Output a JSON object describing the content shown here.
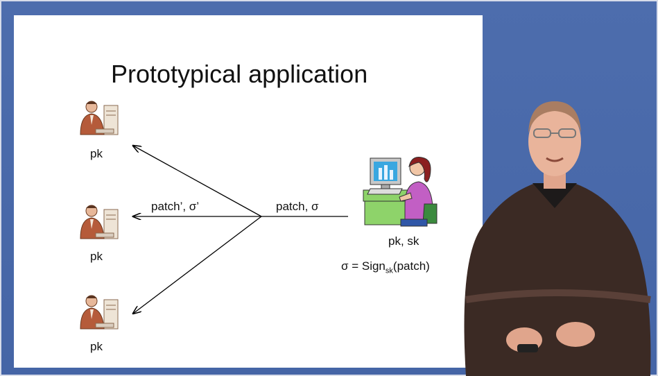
{
  "slide": {
    "title": "Prototypical application",
    "recipients": [
      {
        "label": "pk"
      },
      {
        "label": "pk"
      },
      {
        "label": "pk"
      }
    ],
    "sender": {
      "keys_label": "pk, sk",
      "formula_prefix": "σ = Sign",
      "formula_sub": "sk",
      "formula_suffix": "(patch)"
    },
    "edge_labels": {
      "incoming": "patch, σ",
      "outgoing": "patch’, σ’"
    }
  },
  "colors": {
    "background_blue": "#4a6aaa",
    "slide_white": "#ffffff",
    "sender_shirt": "#c25fc4",
    "recipient_tone": "#b55b3a"
  }
}
